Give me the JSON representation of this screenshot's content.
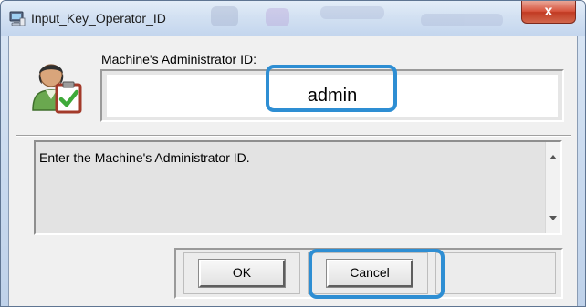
{
  "window": {
    "title": "Input_Key_Operator_ID",
    "close_glyph": "x",
    "app_icon": "computer-icon",
    "close_icon": "close-icon"
  },
  "form": {
    "avatar_icon": "user-clipboard-icon",
    "id_label": "Machine's Administrator ID:",
    "id_value": "admin"
  },
  "message": {
    "text": "Enter the Machine's Administrator ID.",
    "scroll_up_icon": "scroll-up-arrow-icon",
    "scroll_down_icon": "scroll-down-arrow-icon"
  },
  "buttons": {
    "ok_label": "OK",
    "cancel_label": "Cancel"
  },
  "colors": {
    "highlight": "#2e8ed3",
    "close_button": "#c13a22",
    "dialog_background": "#f0f0f0"
  }
}
